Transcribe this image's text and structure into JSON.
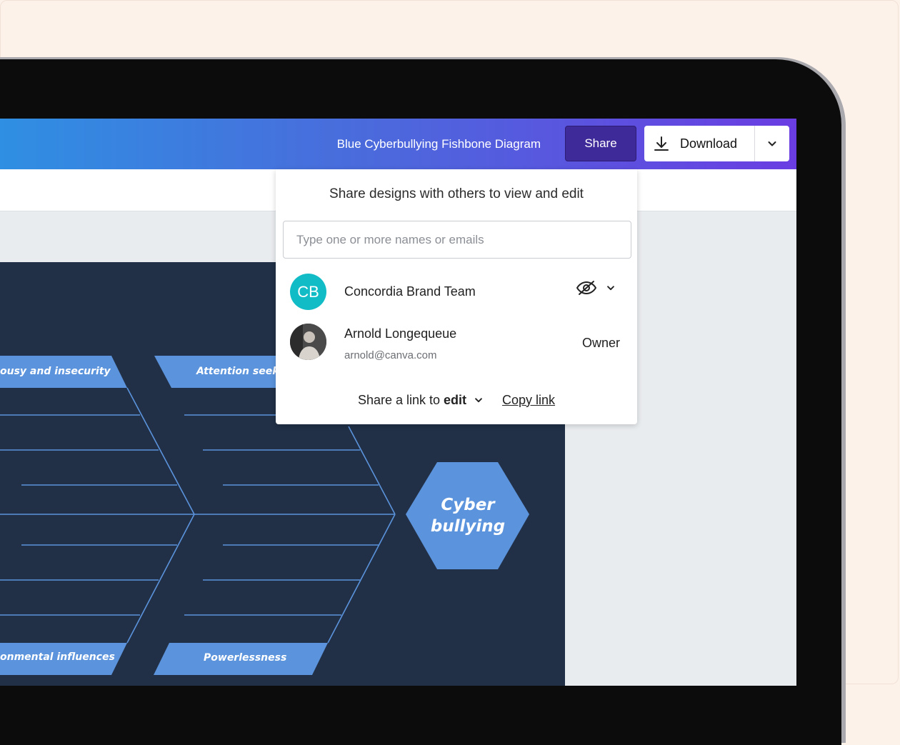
{
  "document": {
    "title": "Blue Cyberbullying Fishbone Diagram"
  },
  "toolbar": {
    "share_label": "Share",
    "download_label": "Download",
    "download_icon": "download-icon",
    "more_icon": "chevron-down-icon"
  },
  "share_panel": {
    "heading": "Share designs with others to view and edit",
    "input_placeholder": "Type one or more names or emails",
    "members": [
      {
        "initials": "CB",
        "name": "Concordia Brand Team",
        "permission_icon": "eye-off-icon",
        "avatar_color": "#12bcc6"
      },
      {
        "name": "Arnold Longequeue",
        "email": "arnold@canva.com",
        "role": "Owner"
      }
    ],
    "link_prefix": "Share a link to",
    "link_access": "edit",
    "copy_link": "Copy link"
  },
  "diagram": {
    "head_line1": "Cyber",
    "head_line2": "bullying",
    "labels": {
      "top_left": "ousy and insecurity",
      "top_right": "Attention seeki",
      "bottom_left": "onmental influences",
      "bottom_right": "Powerlessness"
    }
  },
  "colors": {
    "topbar_start": "#2f8fe2",
    "topbar_end": "#6a3de2",
    "share_button": "#3f2a9a",
    "canvas_background": "#213047",
    "diagram_accent": "#5b93dc"
  }
}
